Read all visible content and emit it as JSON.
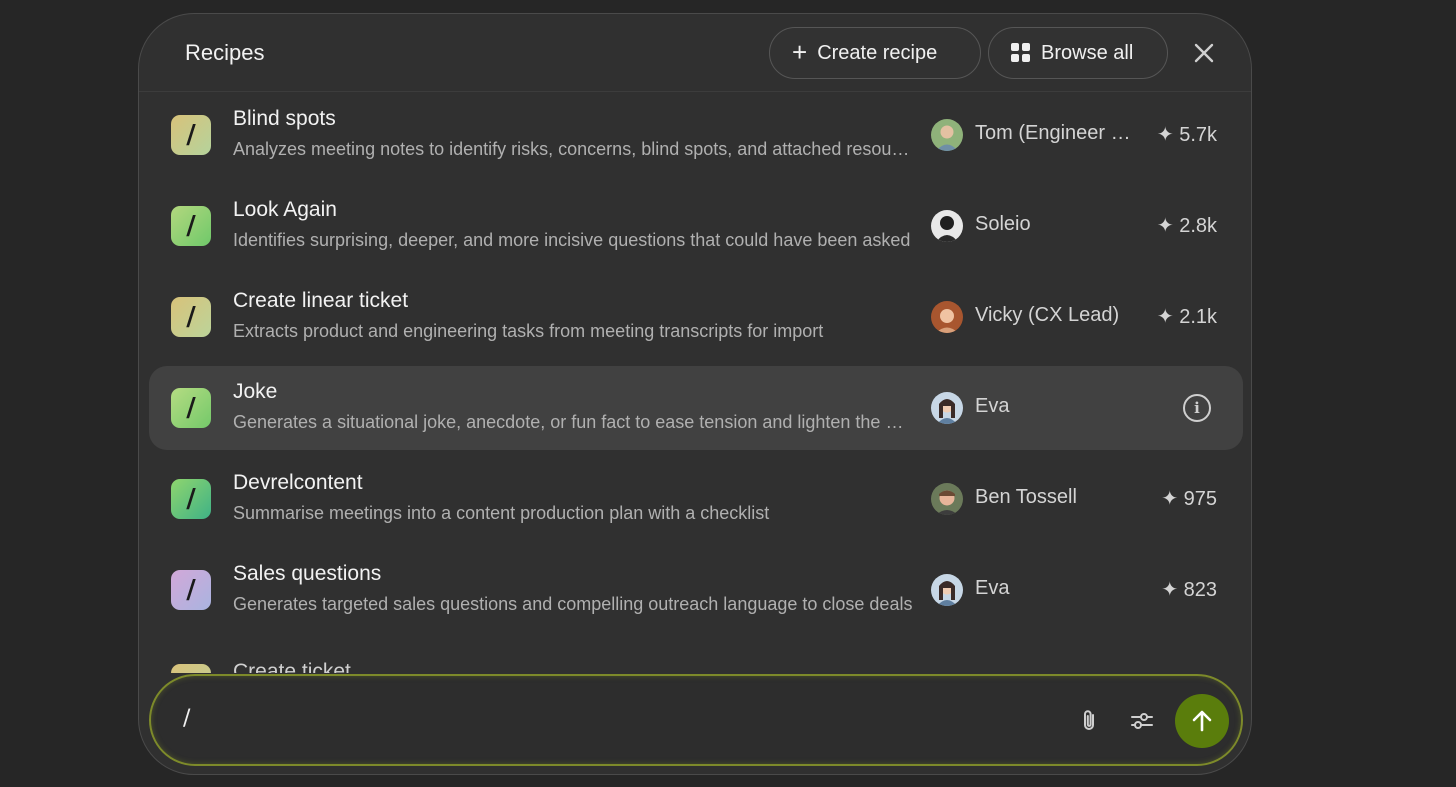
{
  "header": {
    "title": "Recipes",
    "create_label": "Create recipe",
    "browse_label": "Browse all"
  },
  "recipes": [
    {
      "name": "Blind spots",
      "desc": "Analyzes meeting notes to identify risks, concerns, blind spots, and attached resources",
      "author": "Tom (Engineer Lead)",
      "stat": "✦ 5.7k",
      "icon_gradient": [
        "#d8c27a",
        "#b5d39c"
      ]
    },
    {
      "name": "Look Again",
      "desc": "Identifies surprising, deeper, and more incisive questions that could have been asked",
      "author": "Soleio",
      "stat": "✦ 2.8k",
      "icon_gradient": [
        "#b3d77e",
        "#6fc96a"
      ]
    },
    {
      "name": "Create linear ticket",
      "desc": "Extracts product and engineering tasks from meeting transcripts for import",
      "author": "Vicky (CX Lead)",
      "stat": "✦ 2.1k",
      "icon_gradient": [
        "#d8c27a",
        "#bcd49a"
      ]
    },
    {
      "name": "Joke",
      "desc": "Generates a situational joke, anecdote, or fun fact to ease tension and lighten the mood",
      "author": "Eva",
      "stat": "",
      "icon_gradient": [
        "#b5dc82",
        "#74c96a"
      ]
    },
    {
      "name": "Devrelcontent",
      "desc": "Summarise meetings into a content production plan with a checklist",
      "author": "Ben Tossell",
      "stat": "✦ 975",
      "icon_gradient": [
        "#8fd56e",
        "#3fb286"
      ]
    },
    {
      "name": "Sales questions",
      "desc": "Generates targeted sales questions and compelling outreach language to close deals",
      "author": "Eva",
      "stat": "✦ 823",
      "icon_gradient": [
        "#d2a8d8",
        "#a9b4e0"
      ]
    }
  ],
  "partial_item": {
    "name": "Create ticket"
  },
  "composer": {
    "value": "/"
  },
  "colors": {
    "accent": "#5a7d0c",
    "composer_border": "#7d8a2a",
    "panel": "#303030",
    "background": "#262626"
  }
}
